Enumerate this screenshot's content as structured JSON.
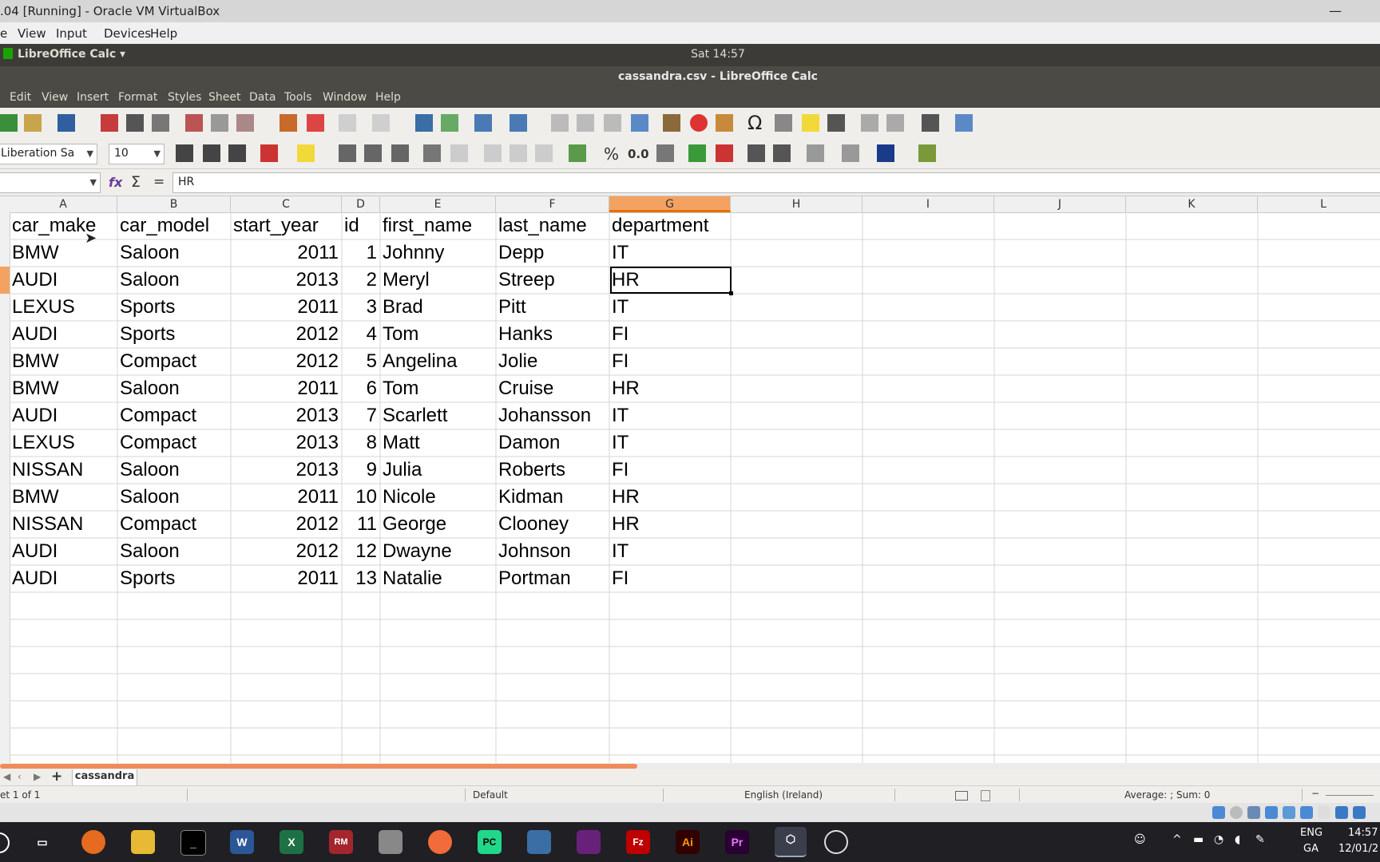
{
  "vbox": {
    "title": ".04 [Running] - Oracle VM VirtualBox",
    "minimize": "—",
    "menu": [
      "e",
      "View",
      "Input",
      "Devices",
      "Help"
    ]
  },
  "ubuntu": {
    "app_menu": "LibreOffice Calc",
    "clock": "Sat 14:57"
  },
  "window": {
    "title": "cassandra.csv - LibreOffice Calc"
  },
  "menu": [
    "Edit",
    "View",
    "Insert",
    "Format",
    "Styles",
    "Sheet",
    "Data",
    "Tools",
    "Window",
    "Help"
  ],
  "toolbar": {
    "font_name": "Liberation Sans",
    "font_size": "10",
    "percent": "%",
    "number_format": "0.0",
    "omega": "Ω"
  },
  "formula": {
    "name_box": "",
    "content": "HR"
  },
  "columns": [
    "A",
    "B",
    "C",
    "D",
    "E",
    "F",
    "G",
    "H",
    "I",
    "J",
    "K",
    "L"
  ],
  "selected_column": "G",
  "rows": [
    [
      "car_make",
      "car_model",
      "start_year",
      "id",
      "first_name",
      "last_name",
      "department"
    ],
    [
      "BMW",
      "Saloon",
      "2011",
      "1",
      "Johnny",
      "Depp",
      "IT"
    ],
    [
      "AUDI",
      "Saloon",
      "2013",
      "2",
      "Meryl",
      "Streep",
      "HR"
    ],
    [
      "LEXUS",
      "Sports",
      "2011",
      "3",
      "Brad",
      "Pitt",
      "IT"
    ],
    [
      "AUDI",
      "Sports",
      "2012",
      "4",
      "Tom",
      "Hanks",
      "FI"
    ],
    [
      "BMW",
      "Compact",
      "2012",
      "5",
      "Angelina",
      "Jolie",
      "FI"
    ],
    [
      "BMW",
      "Saloon",
      "2011",
      "6",
      "Tom",
      "Cruise",
      "HR"
    ],
    [
      "AUDI",
      "Compact",
      "2013",
      "7",
      "Scarlett",
      "Johansson",
      "IT"
    ],
    [
      "LEXUS",
      "Compact",
      "2013",
      "8",
      "Matt",
      "Damon",
      "IT"
    ],
    [
      "NISSAN",
      "Saloon",
      "2013",
      "9",
      "Julia",
      "Roberts",
      "FI"
    ],
    [
      "BMW",
      "Saloon",
      "2011",
      "10",
      "Nicole",
      "Kidman",
      "HR"
    ],
    [
      "NISSAN",
      "Compact",
      "2012",
      "11",
      "George",
      "Clooney",
      "HR"
    ],
    [
      "AUDI",
      "Saloon",
      "2012",
      "12",
      "Dwayne",
      "Johnson",
      "IT"
    ],
    [
      "AUDI",
      "Sports",
      "2011",
      "13",
      "Natalie",
      "Portman",
      "FI"
    ]
  ],
  "sheet_tab": "cassandra",
  "status": {
    "sheet_info": "et 1 of 1",
    "page_style": "Default",
    "language": "English (Ireland)",
    "aggregate": "Average: ; Sum: 0"
  },
  "taskbar": {
    "apps": [
      "cortana-icon",
      "task-view-icon",
      "firefox-icon",
      "file-explorer-icon",
      "terminal-icon",
      "word-icon",
      "excel-icon",
      "rm-icon",
      "paint-icon",
      "postman-icon",
      "pycharm-icon",
      "network-icon",
      "visual-studio-icon",
      "filezilla-icon",
      "illustrator-icon",
      "premiere-icon",
      "virtualbox-icon",
      "obs-icon"
    ],
    "word_label": "W",
    "excel_label": "X",
    "rm_label": "RM",
    "pycharm_label": "PC",
    "filezilla_label": "Fz",
    "illustrator_label": "Ai",
    "premiere_label": "Pr",
    "lang": "ENG",
    "lang_sub": "GA",
    "time": "14:57",
    "date": "12/01/2"
  },
  "colors": {
    "selection_accent": "#f4a261",
    "taskbar_bg": "#1f1f24",
    "ubuntu_panel": "#3c3b37"
  }
}
